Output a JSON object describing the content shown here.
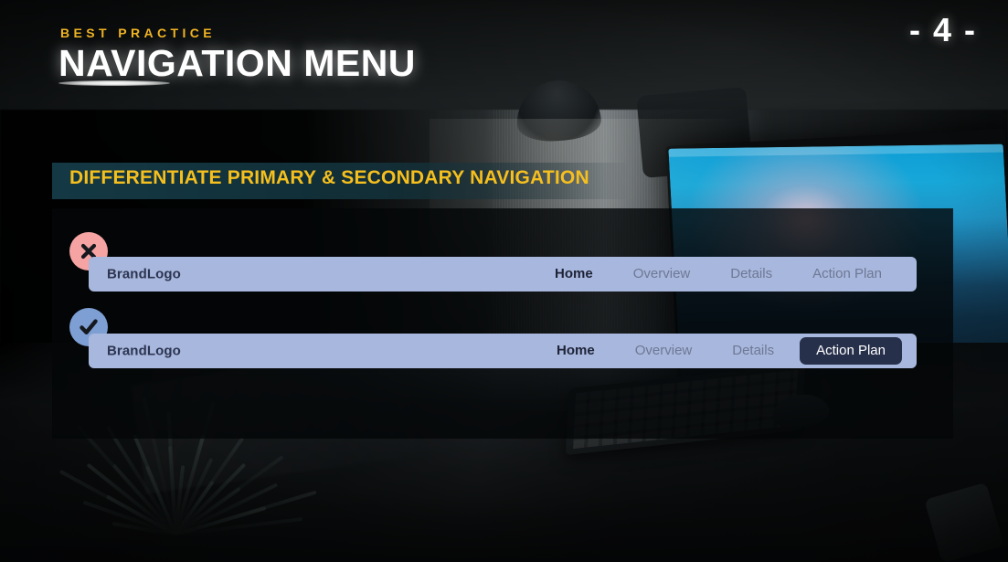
{
  "header": {
    "eyebrow": "BEST PRACTICE",
    "title": "NAVIGATION MENU",
    "page_number": "- 4 -"
  },
  "subtitle": {
    "text": "DIFFERENTIATE PRIMARY & SECONDARY NAVIGATION"
  },
  "examples": [
    {
      "status": "bad",
      "status_icon": "x-circle-icon",
      "brand": "BrandLogo",
      "items": [
        {
          "label": "Home",
          "style": "bold"
        },
        {
          "label": "Overview",
          "style": "muted"
        },
        {
          "label": "Details",
          "style": "muted"
        },
        {
          "label": "Action Plan",
          "style": "muted"
        }
      ]
    },
    {
      "status": "good",
      "status_icon": "check-circle-icon",
      "brand": "BrandLogo",
      "items": [
        {
          "label": "Home",
          "style": "bold"
        },
        {
          "label": "Overview",
          "style": "muted"
        },
        {
          "label": "Details",
          "style": "muted"
        },
        {
          "label": "Action Plan",
          "style": "pill"
        }
      ]
    }
  ],
  "colors": {
    "accent_yellow": "#f0b323",
    "subtitle_yellow": "#f5bf1e",
    "navbar_bg": "#a8b7dd",
    "navbar_text_active": "#1e2437",
    "navbar_text_muted": "#6e7894",
    "pill_bg": "#27304b",
    "badge_bad": "#f5a3a3",
    "badge_good": "#7d9fd4",
    "panel_bg": "#040607",
    "subtitle_band": "#163e4a"
  }
}
